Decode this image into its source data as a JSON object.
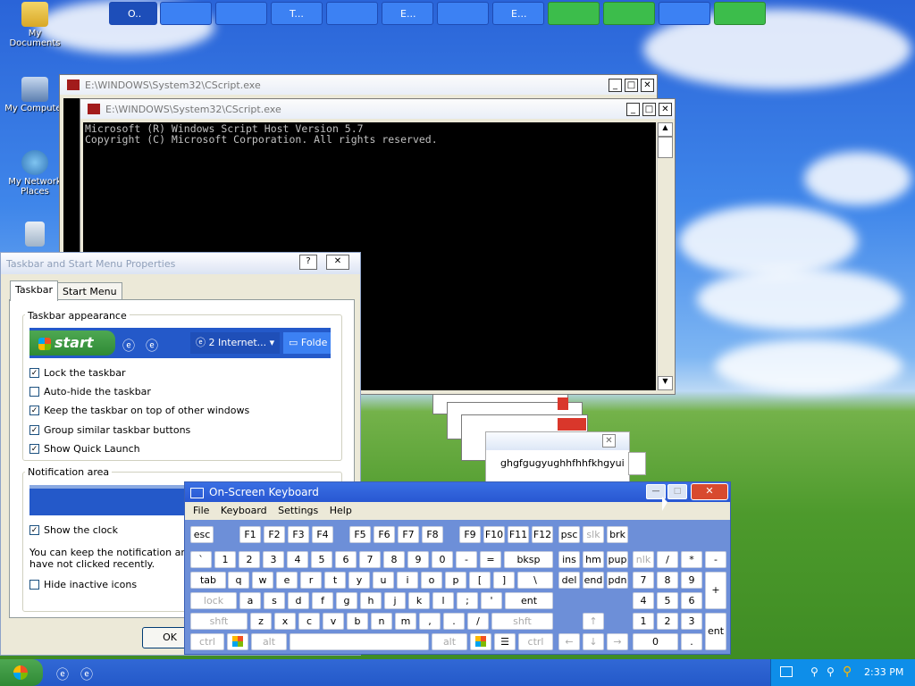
{
  "desktop": {
    "icons": [
      {
        "label": "My Documents"
      },
      {
        "label": "My Computer"
      },
      {
        "label": "My Network Places"
      }
    ]
  },
  "cscript_back": {
    "title": "E:\\WINDOWS\\System32\\CScript.exe"
  },
  "cscript_front": {
    "title": "E:\\WINDOWS\\System32\\CScript.exe",
    "lines": [
      "Microsoft (R) Windows Script Host Version 5.7",
      "Copyright (C) Microsoft Corporation. All rights reserved."
    ]
  },
  "small_window": {
    "text": "ghgfgugyughhfhhfkhgyui"
  },
  "taskbar_props": {
    "title": "Taskbar and Start Menu Properties",
    "tabs": [
      "Taskbar",
      "Start Menu"
    ],
    "appearance_label": "Taskbar appearance",
    "preview": {
      "start": "start",
      "task": "2 Internet...",
      "folder": "Folde"
    },
    "options": [
      {
        "label": "Lock the taskbar",
        "checked": true
      },
      {
        "label": "Auto-hide the taskbar",
        "checked": false
      },
      {
        "label": "Keep the taskbar on top of other windows",
        "checked": true
      },
      {
        "label": "Group similar taskbar buttons",
        "checked": true
      },
      {
        "label": "Show Quick Launch",
        "checked": true
      }
    ],
    "notification_label": "Notification area",
    "show_clock": {
      "label": "Show the clock",
      "checked": true
    },
    "info_text_1": "You can keep the notification area u",
    "info_text_2": "have not clicked recently.",
    "hide_inactive": {
      "label": "Hide inactive icons",
      "checked": false
    },
    "ok_label": "OK"
  },
  "osk": {
    "title": "On-Screen Keyboard",
    "menu": [
      "File",
      "Keyboard",
      "Settings",
      "Help"
    ],
    "row1": [
      "esc",
      "F1",
      "F2",
      "F3",
      "F4",
      "F5",
      "F6",
      "F7",
      "F8",
      "F9",
      "F10",
      "F11",
      "F12",
      "psc",
      "slk",
      "brk"
    ],
    "row2": [
      "`",
      "1",
      "2",
      "3",
      "4",
      "5",
      "6",
      "7",
      "8",
      "9",
      "0",
      "-",
      "=",
      "bksp",
      "ins",
      "hm",
      "pup",
      "nlk",
      "/",
      "*",
      "-"
    ],
    "row3": [
      "tab",
      "q",
      "w",
      "e",
      "r",
      "t",
      "y",
      "u",
      "i",
      "o",
      "p",
      "[",
      "]",
      "\\",
      "del",
      "end",
      "pdn",
      "7",
      "8",
      "9",
      "+"
    ],
    "row4": [
      "lock",
      "a",
      "s",
      "d",
      "f",
      "g",
      "h",
      "j",
      "k",
      "l",
      ";",
      "'",
      "ent",
      "4",
      "5",
      "6"
    ],
    "row5": [
      "shft",
      "z",
      "x",
      "c",
      "v",
      "b",
      "n",
      "m",
      ",",
      ".",
      "/",
      "shft",
      "1",
      "2",
      "3"
    ],
    "row6": [
      "ctrl",
      "alt",
      "alt",
      "ctrl",
      "0",
      ".",
      "ent"
    ]
  },
  "taskbar": {
    "tasks": [
      "O..",
      "",
      "",
      "T...",
      "",
      "E...",
      "",
      "E...",
      "",
      "",
      "",
      "",
      ""
    ],
    "clock": "2:33 PM"
  }
}
